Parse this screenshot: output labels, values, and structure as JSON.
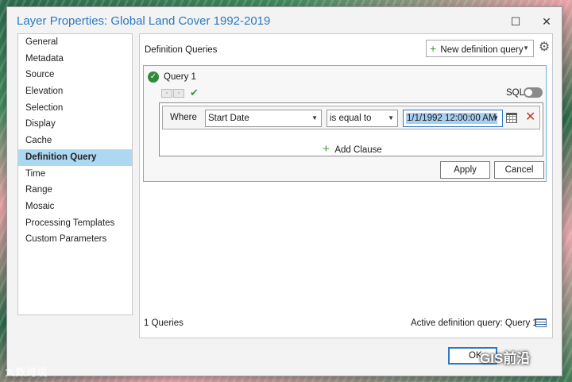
{
  "window": {
    "title": "Layer Properties: Global Land Cover 1992-2019",
    "maximize_glyph": "☐",
    "close_glyph": "✕"
  },
  "nav": {
    "items": [
      {
        "label": "General"
      },
      {
        "label": "Metadata"
      },
      {
        "label": "Source"
      },
      {
        "label": "Elevation"
      },
      {
        "label": "Selection"
      },
      {
        "label": "Display"
      },
      {
        "label": "Cache"
      },
      {
        "label": "Definition Query",
        "selected": true
      },
      {
        "label": "Time"
      },
      {
        "label": "Range"
      },
      {
        "label": "Mosaic"
      },
      {
        "label": "Processing Templates"
      },
      {
        "label": "Custom Parameters"
      }
    ]
  },
  "content": {
    "header": "Definition Queries",
    "new_query_label": "New definition query",
    "query": {
      "name": "Query 1",
      "sql_label": "SQL",
      "sql_enabled": false,
      "clause": {
        "where_label": "Where",
        "field": "Start Date",
        "operator": "is equal to",
        "value": "1/1/1992 12:00:00 AM"
      },
      "add_clause_label": "Add Clause",
      "apply_label": "Apply",
      "cancel_label": "Cancel"
    }
  },
  "footer": {
    "count_text": "1 Queries",
    "active_text": "Active definition query: Query 1",
    "ok_label": "OK"
  },
  "watermarks": {
    "left": "大数跨境",
    "right": "GIS前沿"
  },
  "colors": {
    "accent": "#2b79c2",
    "selected_nav": "#add8f2",
    "success_green": "#2e8b3a",
    "remove_red": "#c0392b"
  },
  "icons": [
    "maximize-icon",
    "close-icon",
    "plus-icon",
    "chevron-down-icon",
    "gear-icon",
    "check-circle-icon",
    "check-icon",
    "calendar-icon",
    "remove-icon",
    "list-icon"
  ]
}
